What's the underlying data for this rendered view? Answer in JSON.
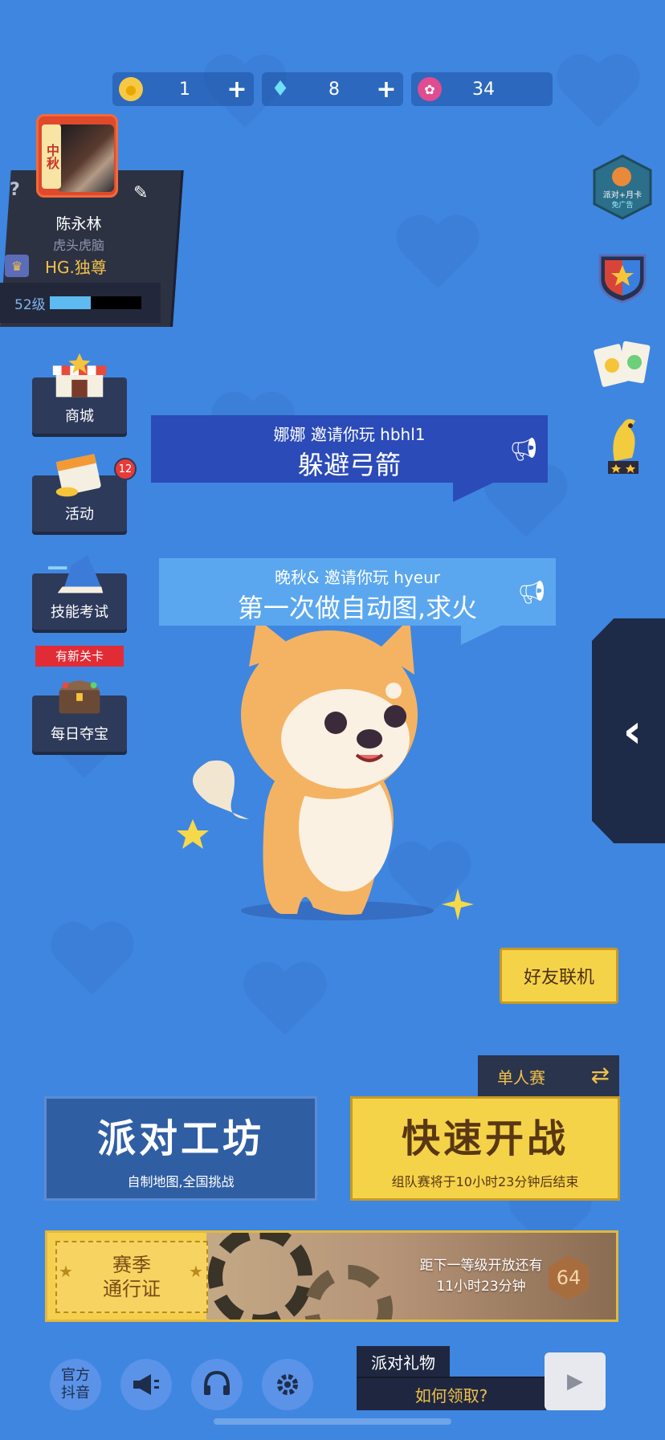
{
  "currency": {
    "coins": "1",
    "gems": "8",
    "flowers": "34"
  },
  "profile": {
    "avatar_tag": "中秋",
    "help": "?",
    "name": "陈永林",
    "title": "虎头虎脑",
    "guild": "HG.独尊",
    "level": "52级",
    "xp_fraction": 0.45
  },
  "left_menu": {
    "shop": "商城",
    "events": "活动",
    "events_badge": "12",
    "skill_test": "技能考试",
    "new_tag": "有新关卡",
    "daily_treasure": "每日夺宝"
  },
  "right_icons": {
    "party_card": "派对+月卡",
    "party_card_sub": "免广告"
  },
  "invites": [
    {
      "line1": "娜娜 邀请你玩 hbhl1",
      "line2": "躲避弓箭"
    },
    {
      "line1": "晚秋& 邀请你玩 hyeur",
      "line2": "第一次做自动图,求火"
    }
  ],
  "buttons": {
    "friends": "好友联机",
    "mode": "单人赛",
    "workshop_title": "派对工坊",
    "workshop_sub": "自制地图,全国挑战",
    "start_title": "快速开战",
    "start_sub": "组队赛将于10小时23分钟后结束"
  },
  "pass": {
    "ticket_line1": "赛季",
    "ticket_line2": "通行证",
    "info_line1": "距下一等级开放还有",
    "info_line2": "11小时23分钟",
    "level": "64"
  },
  "bottom": {
    "douyin_line1": "官方",
    "douyin_line2": "抖音",
    "gift_title": "派对礼物",
    "gift_link": "如何领取?"
  },
  "colors": {
    "background": "#3f86e0",
    "accent_yellow": "#f5d349",
    "panel_dark": "#2d3243"
  }
}
